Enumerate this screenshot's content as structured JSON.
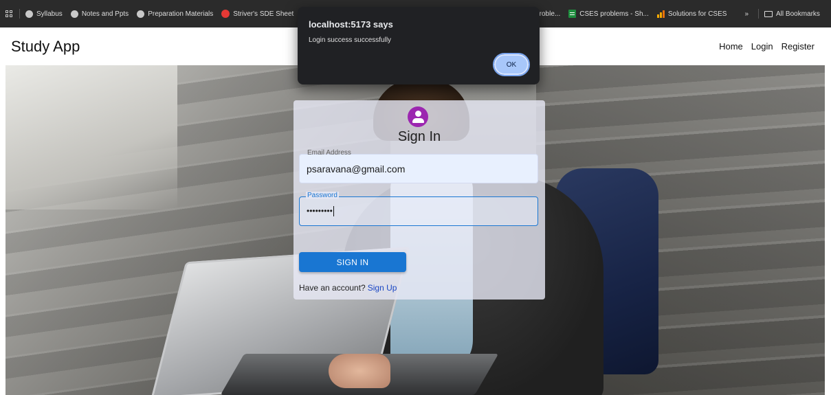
{
  "bookmarks": {
    "items": [
      {
        "label": "Syllabus",
        "icon": "globe-icon"
      },
      {
        "label": "Notes and Ppts",
        "icon": "globe-icon"
      },
      {
        "label": "Preparation Materials",
        "icon": "globe-icon"
      },
      {
        "label": "Striver's SDE Sheet",
        "icon": "tuf-icon"
      }
    ],
    "right_items": [
      {
        "label": "Proble...",
        "icon": "none"
      },
      {
        "label": "CSES problems - Sh...",
        "icon": "sheets-icon"
      },
      {
        "label": "Solutions for CSES",
        "icon": "bars-icon"
      }
    ],
    "overflow_label": "»",
    "all_bookmarks_label": "All Bookmarks"
  },
  "navbar": {
    "brand": "Study App",
    "links": [
      "Home",
      "Login",
      "Register"
    ]
  },
  "signin": {
    "title": "Sign In",
    "email_label": "Email Address",
    "email_value": "psaravana@gmail.com",
    "password_label": "Password",
    "password_value": "•••••••••",
    "submit_label": "SIGN IN",
    "account_prompt": "Have an account?",
    "signup_label": "Sign Up"
  },
  "alert": {
    "title": "localhost:5173 says",
    "message": "Login success successfully",
    "ok_label": "OK"
  },
  "colors": {
    "primary": "#1976d2",
    "avatar": "#9c27b0",
    "link": "#1a46c4",
    "dialog_bg": "#202124",
    "ok_button": "#a8c7fa"
  }
}
